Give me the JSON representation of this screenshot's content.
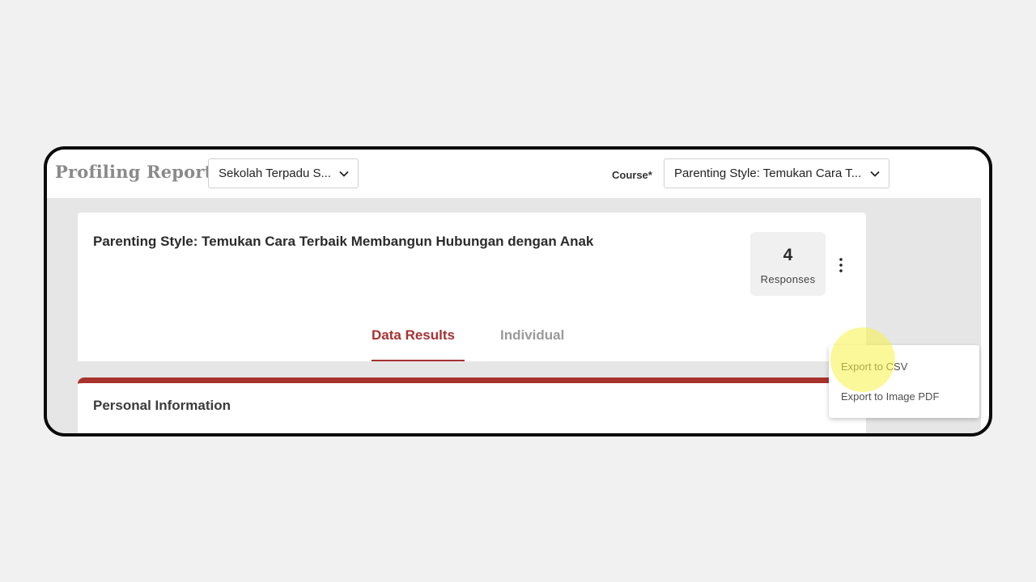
{
  "header": {
    "title": "Profiling Report",
    "school_select_value": "Sekolah Terpadu S...",
    "course_label": "Course*",
    "course_select_value": "Parenting Style: Temukan Cara T..."
  },
  "card": {
    "title": "Parenting Style: Temukan Cara Terbaik Membangun Hubungan dengan Anak",
    "responses_count": "4",
    "responses_label": "Responses"
  },
  "tabs": [
    {
      "label": "Data Results",
      "active": true
    },
    {
      "label": "Individual",
      "active": false
    }
  ],
  "section": {
    "title": "Personal Information"
  },
  "menu": {
    "items": [
      {
        "label": "Export to CSV"
      },
      {
        "label": "Export to Image PDF"
      }
    ]
  },
  "icons": {
    "chevron": "chevron-down-icon",
    "kebab": "kebab-menu-icon"
  },
  "colors": {
    "accent": "#a83232",
    "highlight": "#f6f246",
    "page_bg": "#f1f1f1",
    "content_bg": "#e6e6e6"
  }
}
